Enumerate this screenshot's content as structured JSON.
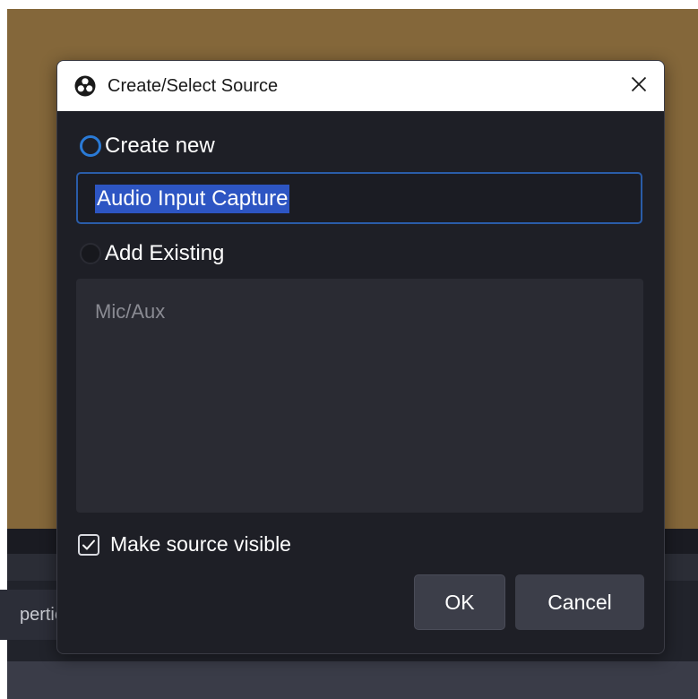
{
  "background": {
    "properties_button_label": "pertie"
  },
  "dialog": {
    "title": "Create/Select Source",
    "create_new_label": "Create new",
    "create_new_checked": true,
    "source_name_value": "Audio Input Capture",
    "add_existing_label": "Add Existing",
    "add_existing_checked": false,
    "existing_sources": [
      "Mic/Aux"
    ],
    "make_visible_label": "Make source visible",
    "make_visible_checked": true,
    "ok_label": "OK",
    "cancel_label": "Cancel"
  },
  "colors": {
    "accent": "#2a7ad6",
    "selection": "#2d55c3",
    "dialog_bg": "#1e1f26",
    "preview_bg": "#84673a"
  },
  "icons": {
    "app_icon": "obs-logo-icon",
    "close_icon": "close-icon",
    "check_icon": "checkmark-icon"
  }
}
